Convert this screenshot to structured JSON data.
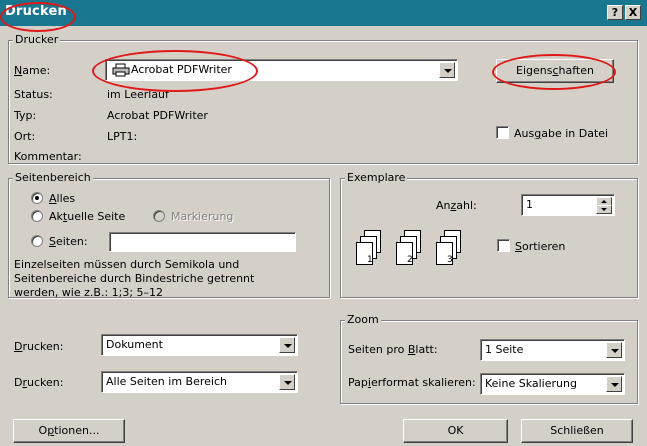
{
  "window": {
    "title": "Drucken",
    "help_btn": "?",
    "close_btn": "X"
  },
  "printer_group": {
    "legend": "Drucker",
    "name_label": "Name:",
    "name_value": "Acrobat PDFWriter",
    "status_label": "Status:",
    "status_value": "im Leerlauf",
    "type_label": "Typ:",
    "type_value": "Acrobat PDFWriter",
    "location_label": "Ort:",
    "location_value": "LPT1:",
    "comment_label": "Kommentar:",
    "properties_button": "Eigenschaften",
    "print_to_file": "Ausgabe in Datei"
  },
  "page_range": {
    "legend": "Seitenbereich",
    "all": "Alles",
    "current_page": "Aktuelle Seite",
    "selection": "Markierung",
    "pages": "Seiten:",
    "pages_value": "",
    "hint": [
      "Einzelseiten müssen durch Semikola und",
      "Seitenbereiche durch Bindestriche getrennt",
      "werden, wie z.B.: 1;3; 5–12"
    ]
  },
  "copies": {
    "legend": "Exemplare",
    "count_label": "Anzahl:",
    "count_value": "1",
    "collate": "Sortieren",
    "page_numbers": [
      "1",
      "2",
      "3"
    ]
  },
  "print_options": {
    "print_what_label": "Drucken:",
    "print_what_value": "Dokument",
    "print_label": "Drucken:",
    "print_value": "Alle Seiten im Bereich"
  },
  "zoom": {
    "legend": "Zoom",
    "pages_per_sheet_label": "Seiten pro Blatt:",
    "pages_per_sheet_value": "1 Seite",
    "scale_label": "Papierformat skalieren:",
    "scale_value": "Keine Skalierung"
  },
  "footer": {
    "options": "Optionen...",
    "ok": "OK",
    "close": "Schließen"
  },
  "colors": {
    "titlebar": "#18778f",
    "face": "#d4d0c8",
    "annotation": "#e01818"
  }
}
